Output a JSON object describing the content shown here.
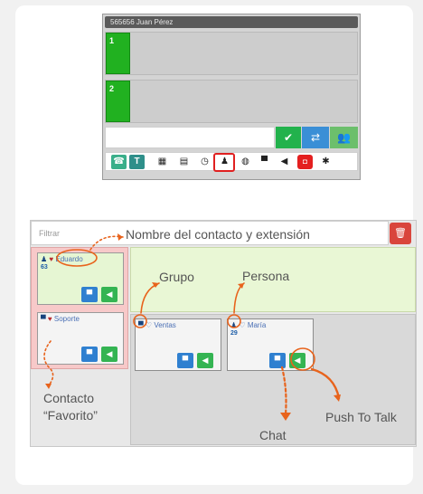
{
  "phone": {
    "title": "565656 Juan Pérez",
    "lines": [
      {
        "num": "1"
      },
      {
        "num": "2"
      }
    ],
    "dial_placeholder": "",
    "toolbar_icons": [
      "phone-icon",
      "text-icon",
      "keypad-icon",
      "calculator-icon",
      "clock-icon",
      "contacts-icon",
      "globe-icon",
      "chat-icon",
      "megaphone-icon",
      "voicemail-icon",
      "settings-icon"
    ]
  },
  "contacts": {
    "filter_placeholder": "Filtrar",
    "favorites": [
      {
        "name": "Eduardo",
        "ext": "63"
      },
      {
        "name": "Soporte",
        "ext": ""
      }
    ],
    "group": {
      "name": "Ventas",
      "ext": ""
    },
    "person": {
      "name": "María",
      "ext": "29"
    }
  },
  "annotations": {
    "contact_name": "Nombre del contacto y extensión",
    "group": "Grupo",
    "person": "Persona",
    "favorite_line1": "Contacto",
    "favorite_line2": "“Favorito”",
    "chat": "Chat",
    "ptt": "Push To Talk"
  },
  "colors": {
    "accent_orange": "#e8631c",
    "green": "#21b120",
    "highlight_red": "#e02020"
  }
}
